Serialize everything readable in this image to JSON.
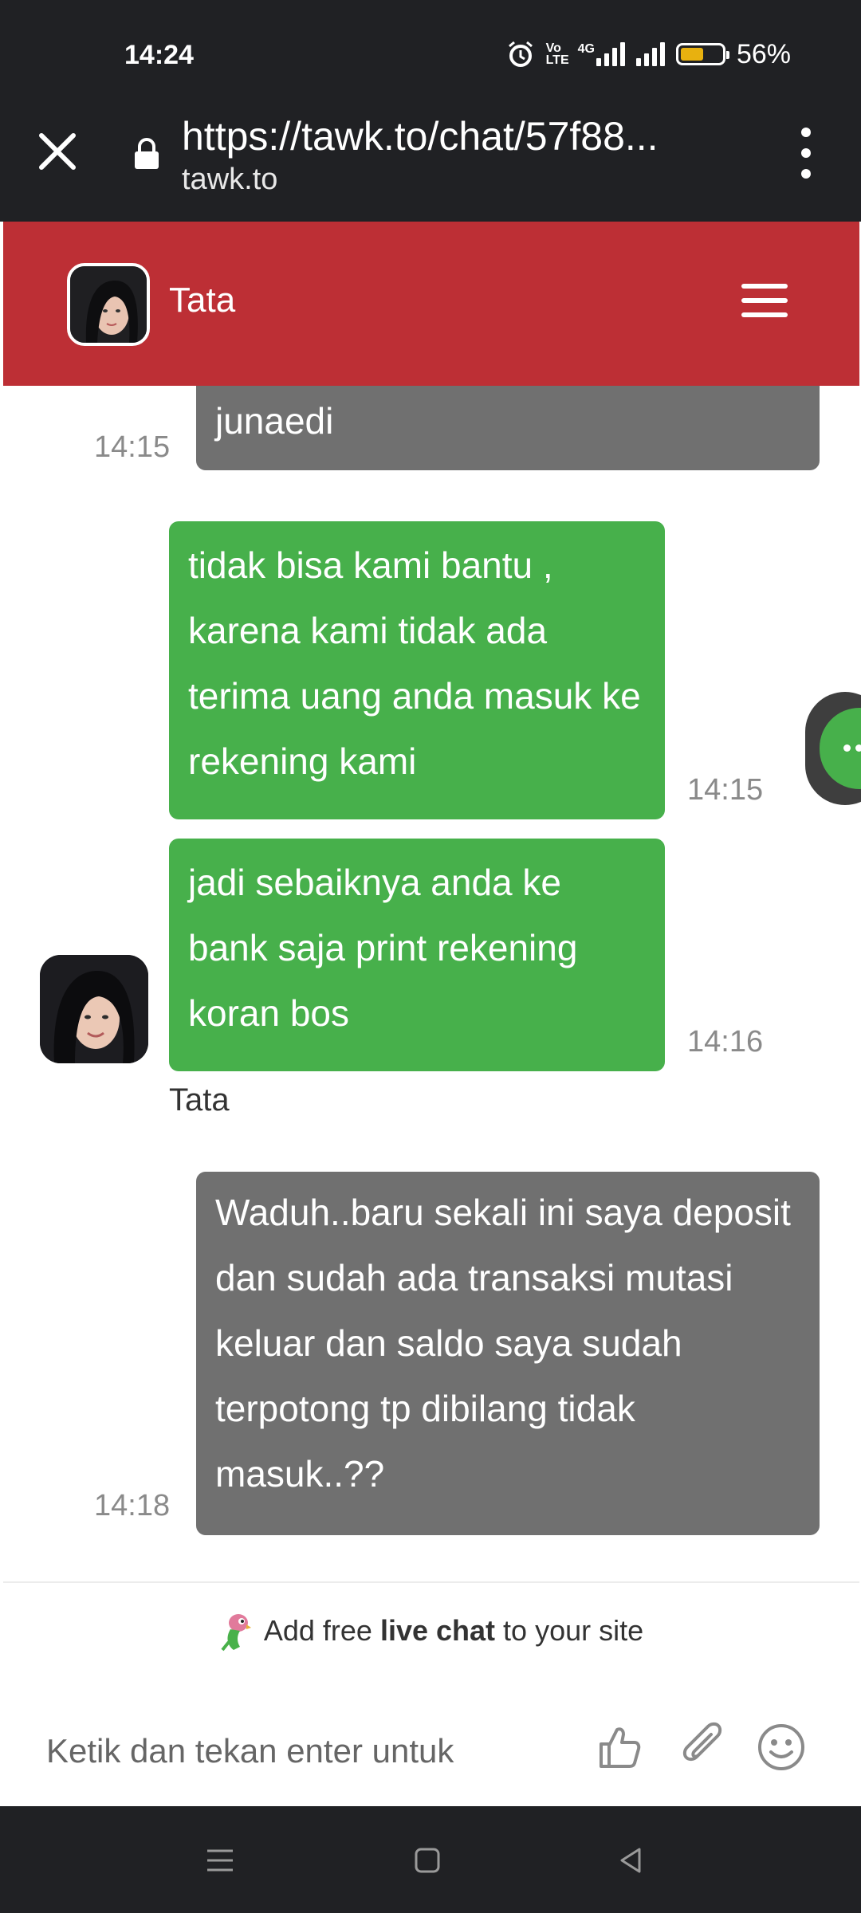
{
  "status_bar": {
    "time": "14:24",
    "network_label": "Vo LTE",
    "network_type": "4G",
    "battery_percent": "56%",
    "battery_level": 0.56
  },
  "browser": {
    "url": "https://tawk.to/chat/57f88...",
    "domain": "tawk.to"
  },
  "chat": {
    "agent_name": "Tata",
    "messages": [
      {
        "from": "visitor",
        "text": "junaedi",
        "time": "14:15"
      },
      {
        "from": "agent",
        "text": "tidak bisa kami bantu , karena kami tidak ada terima uang anda masuk ke rekening kami",
        "time": "14:15"
      },
      {
        "from": "agent",
        "text": "jadi sebaiknya anda ke bank saja print rekening koran bos",
        "time": "14:16"
      },
      {
        "from": "visitor",
        "text": "Waduh..baru sekali ini saya deposit dan sudah ada transaksi mutasi keluar dan saldo saya sudah terpotong tp dibilang tidak masuk..??",
        "time": "14:18"
      }
    ],
    "agent_label": "Tata"
  },
  "footer": {
    "branding_prefix": "Add free",
    "branding_bold": "live chat",
    "branding_suffix": "to your site",
    "input_placeholder": "Ketik dan tekan enter untuk"
  },
  "colors": {
    "header": "#bd2f35",
    "agent_bubble": "#47b04b",
    "visitor_bubble": "#707070",
    "system_bars": "#202124"
  }
}
